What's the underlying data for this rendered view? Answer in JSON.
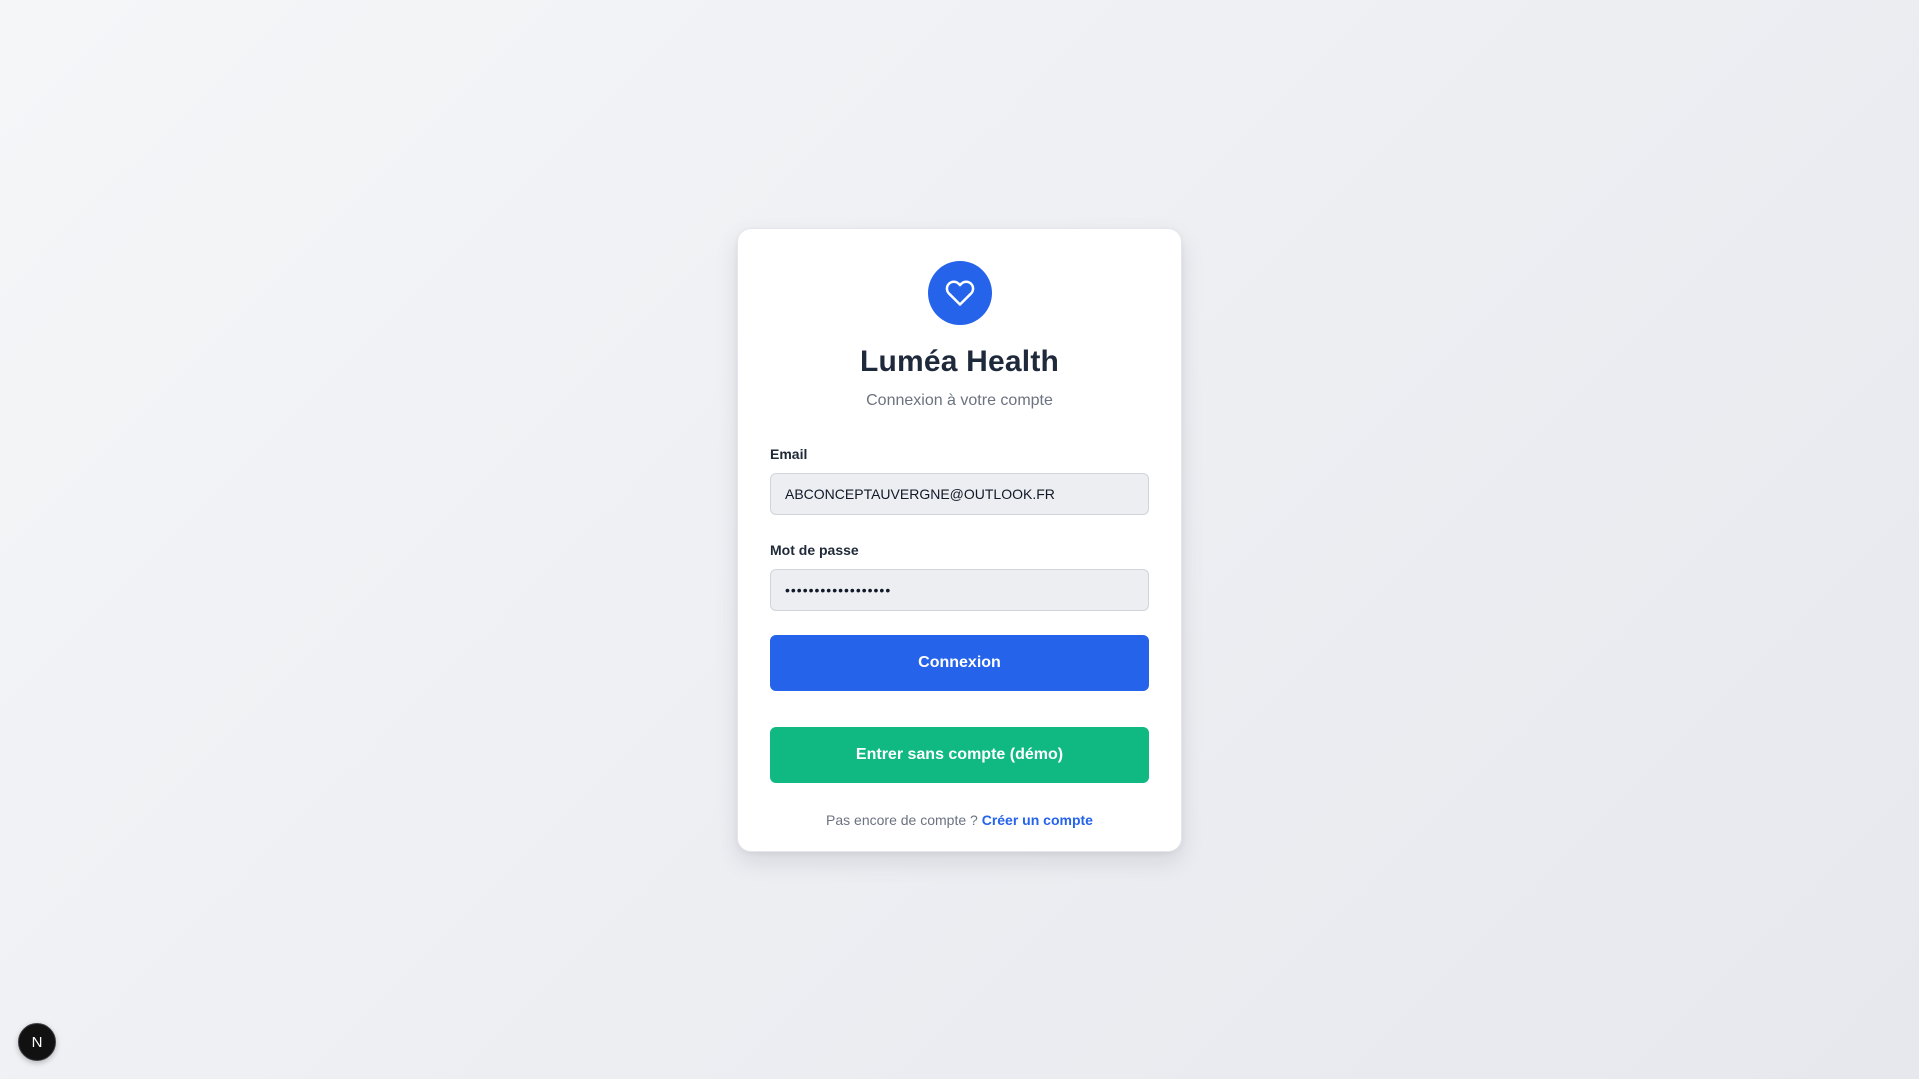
{
  "brand": {
    "logo_icon": "heart-icon",
    "logo_color": "#2563eb",
    "title": "Luméa Health",
    "subtitle": "Connexion à votre compte"
  },
  "form": {
    "email_label": "Email",
    "email_value": "ABCONCEPTAUVERGNE@OUTLOOK.FR",
    "password_label": "Mot de passe",
    "password_value": "••••••••••••••••••",
    "login_button": "Connexion",
    "login_button_color": "#2563eb",
    "demo_button": "Entrer sans compte (démo)",
    "demo_button_color": "#10b981"
  },
  "footer": {
    "prompt": "Pas encore de compte ?",
    "signup_link": "Créer un compte"
  },
  "dev_badge": {
    "label": "N",
    "icon": "nextjs-icon"
  }
}
